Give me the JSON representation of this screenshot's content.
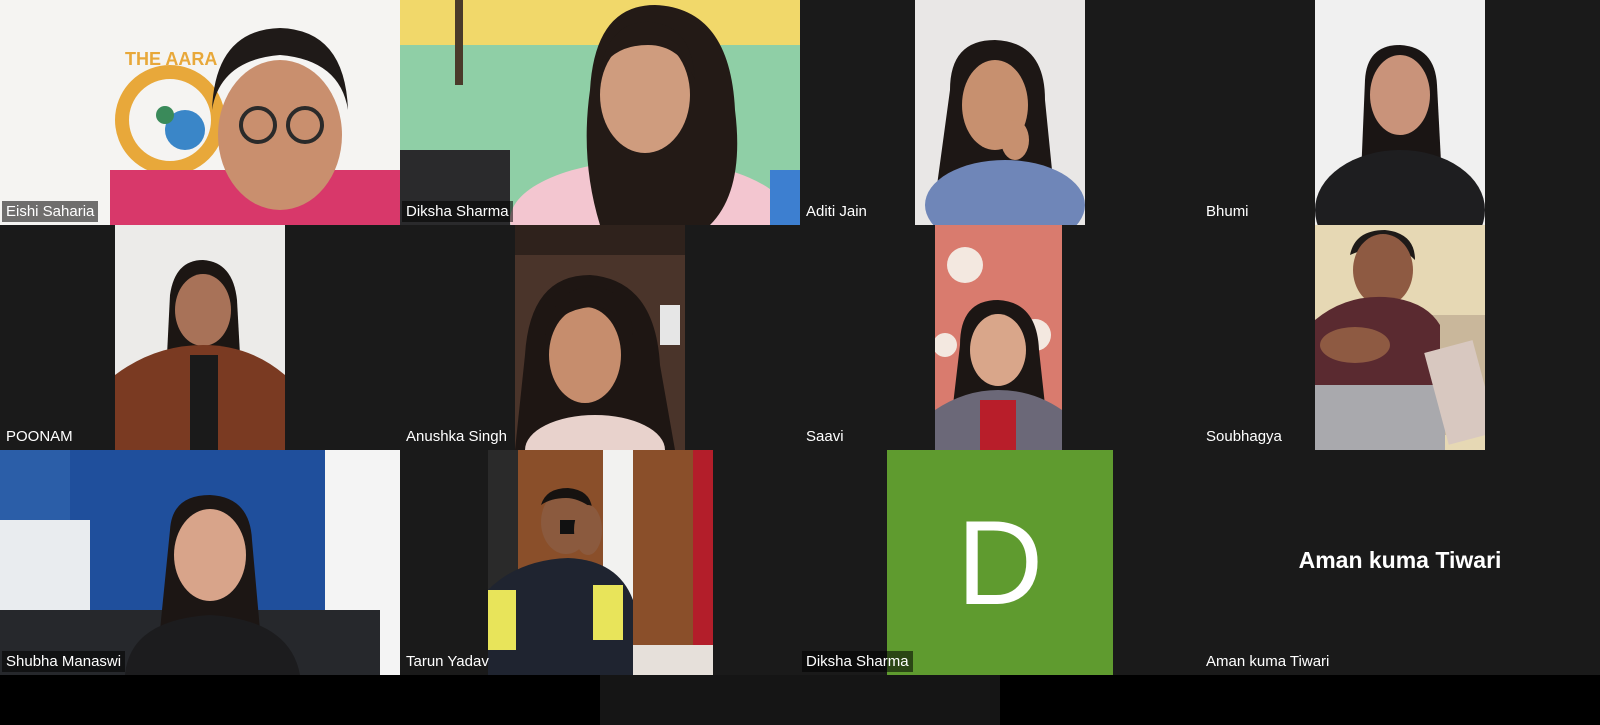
{
  "participants": [
    {
      "name": "Eishi Saharia"
    },
    {
      "name": "Diksha Sharma"
    },
    {
      "name": "Aditi Jain"
    },
    {
      "name": "Bhumi"
    },
    {
      "name": "POONAM"
    },
    {
      "name": "Anushka Singh"
    },
    {
      "name": "Saavi"
    },
    {
      "name": "Soubhagya"
    },
    {
      "name": "Shubha Manaswi"
    },
    {
      "name": "Tarun Yadav"
    },
    {
      "name": "Diksha Sharma",
      "avatar_initial": "D",
      "avatar_color": "#5f9b2f"
    },
    {
      "name": "Aman kuma Tiwari",
      "display_name": "Aman kuma Tiwari"
    }
  ],
  "logo_text": "THE AARA",
  "colors": {
    "background": "#1a1a1a",
    "avatar_green": "#5f9b2f"
  }
}
